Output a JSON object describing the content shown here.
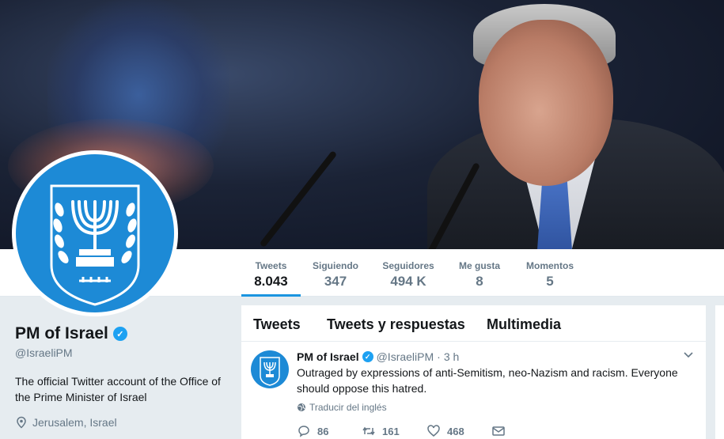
{
  "profile": {
    "name": "PM of Israel",
    "handle": "@IsraeliPM",
    "bio": "The official Twitter account of the Office of the Prime Minister of Israel",
    "location": "Jerusalem, Israel"
  },
  "nav": {
    "stats": [
      {
        "label": "Tweets",
        "value": "8.043",
        "active": true
      },
      {
        "label": "Siguiendo",
        "value": "347"
      },
      {
        "label": "Seguidores",
        "value": "494 K"
      },
      {
        "label": "Me gusta",
        "value": "8"
      },
      {
        "label": "Momentos",
        "value": "5"
      }
    ]
  },
  "timeline": {
    "tabs": [
      "Tweets",
      "Tweets y respuestas",
      "Multimedia"
    ]
  },
  "tweet": {
    "name": "PM of Israel",
    "handle": "@IsraeliPM",
    "dot": "·",
    "time": "3 h",
    "text": "Outraged by expressions of anti-Semitism, neo-Nazism and racism. Everyone should oppose this hatred.",
    "translate": "Traducir del inglés",
    "replies": "86",
    "retweets": "161",
    "likes": "468"
  },
  "colors": {
    "accent": "#1da1f2",
    "emblem_blue": "#1d8ad6",
    "active_underline": "#1b95e0"
  },
  "icons": [
    "verified-badge-icon",
    "location-pin-icon",
    "globe-icon",
    "chevron-down-icon",
    "reply-icon",
    "retweet-icon",
    "like-icon",
    "message-icon"
  ]
}
